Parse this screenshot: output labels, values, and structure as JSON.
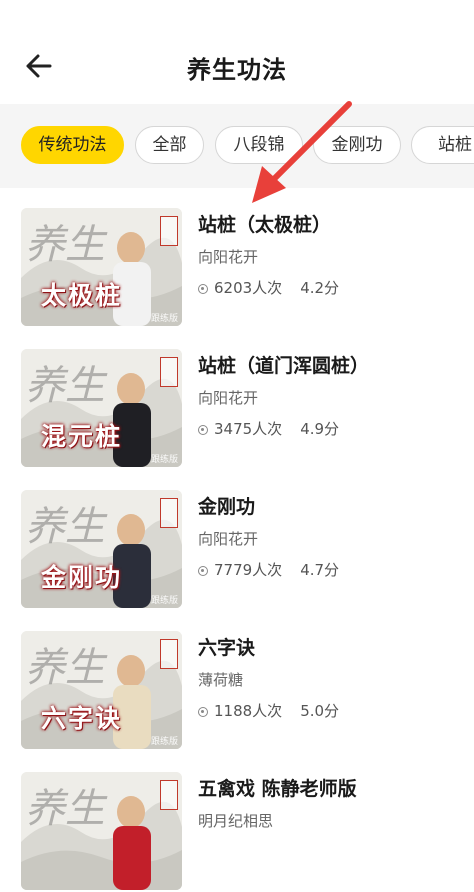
{
  "header": {
    "back_icon": "arrow-left-icon",
    "title": "养生功法"
  },
  "tabs": [
    {
      "label": "传统功法",
      "active": true
    },
    {
      "label": "全部",
      "active": false
    },
    {
      "label": "八段锦",
      "active": false
    },
    {
      "label": "金刚功",
      "active": false
    },
    {
      "label": "站桩",
      "active": false
    }
  ],
  "accent_color": "#ffd600",
  "items": [
    {
      "title": "站桩（太极桩）",
      "author": "向阳花开",
      "views": "6203人次",
      "score": "4.2分",
      "thumb_text": "太极桩",
      "thumb_tag": "跟练版",
      "outfit": "#f2f2f2"
    },
    {
      "title": "站桩（道门浑圆桩）",
      "author": "向阳花开",
      "views": "3475人次",
      "score": "4.9分",
      "thumb_text": "混元桩",
      "thumb_tag": "跟练版",
      "outfit": "#1f1f24"
    },
    {
      "title": "金刚功",
      "author": "向阳花开",
      "views": "7779人次",
      "score": "4.7分",
      "thumb_text": "金刚功",
      "thumb_tag": "跟练版",
      "outfit": "#2b2e3a"
    },
    {
      "title": "六字诀",
      "author": "薄荷糖",
      "views": "1188人次",
      "score": "5.0分",
      "thumb_text": "六字诀",
      "thumb_tag": "跟练版",
      "outfit": "#e9dcc0"
    },
    {
      "title": "五禽戏 陈静老师版",
      "author": "明月纪相思",
      "views": "",
      "score": "",
      "thumb_text": "",
      "thumb_tag": "",
      "outfit": "#c21f2a"
    }
  ],
  "thumb_bg_char": "养生"
}
